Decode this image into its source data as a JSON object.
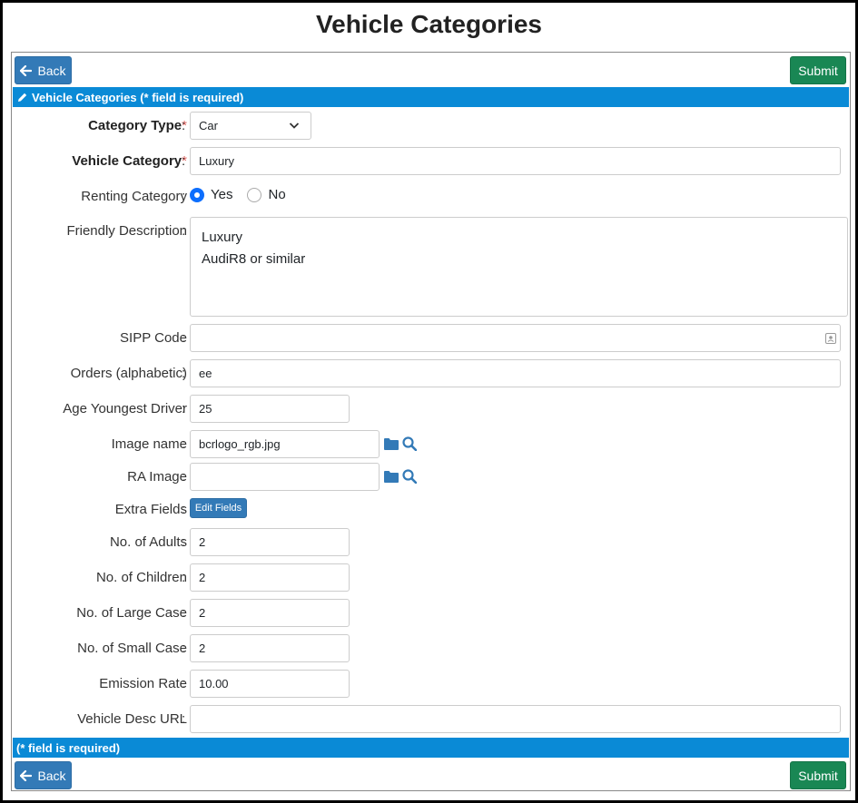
{
  "page": {
    "title": "Vehicle Categories"
  },
  "toolbar": {
    "back_label": "Back",
    "submit_label": "Submit"
  },
  "section": {
    "header": "Vehicle Categories (* field is required)",
    "footer": "(* field is required)"
  },
  "form": {
    "category_type": {
      "label": "Category Type",
      "required_mark": "*",
      "value": "Car"
    },
    "vehicle_category": {
      "label": "Vehicle Category",
      "required_mark": "*",
      "value": "Luxury"
    },
    "renting_category": {
      "label": "Renting Category",
      "option_yes": "Yes",
      "option_no": "No",
      "selected": "Yes"
    },
    "friendly_description": {
      "label": "Friendly Description",
      "value": "Luxury\nAudiR8 or similar"
    },
    "sipp_code": {
      "label": "SIPP Code",
      "value": ""
    },
    "orders": {
      "label": "Orders (alphabetic)",
      "value": "ee"
    },
    "age_youngest_driver": {
      "label": "Age Youngest Driver",
      "value": "25"
    },
    "image_name": {
      "label": "Image name",
      "value": "bcrlogo_rgb.jpg"
    },
    "ra_image": {
      "label": "RA Image",
      "value": ""
    },
    "extra_fields": {
      "label": "Extra Fields",
      "button": "Edit Fields"
    },
    "adults": {
      "label": "No. of Adults",
      "value": "2"
    },
    "children": {
      "label": "No. of Children",
      "value": "2"
    },
    "large_case": {
      "label": "No. of Large Case",
      "value": "2"
    },
    "small_case": {
      "label": "No. of Small Case",
      "value": "2"
    },
    "emission_rate": {
      "label": "Emission Rate",
      "value": "10.00"
    },
    "vehicle_desc_url": {
      "label": "Vehicle Desc URL",
      "value": ""
    }
  },
  "colors": {
    "primary": "#337ab7",
    "success": "#198754",
    "section_bar": "#0a8ad6",
    "required": "#d9534f",
    "radio_selected": "#0d6efd"
  },
  "icons": [
    "arrow-left-icon",
    "pencil-icon",
    "chevron-down-icon",
    "folder-icon",
    "magnifier-icon",
    "contact-card-icon"
  ]
}
